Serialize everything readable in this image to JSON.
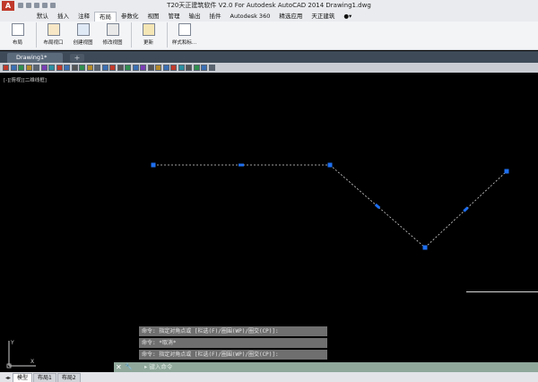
{
  "window": {
    "title": "T20天正建筑软件 V2.0 For Autodesk AutoCAD 2014    Drawing1.dwg",
    "app_logo": "A"
  },
  "menu": {
    "items": [
      "默认",
      "插入",
      "注释",
      "布局",
      "参数化",
      "视图",
      "管理",
      "输出",
      "插件",
      "Autodesk 360",
      "精选应用",
      "天正建筑",
      "●▾"
    ],
    "active_index": 3
  },
  "ribbon": {
    "buttons": [
      {
        "label": "布局",
        "icon": "layout-icon"
      },
      {
        "label": "布局视口",
        "icon": "viewport-icon"
      },
      {
        "label": "创建视图",
        "icon": "create-view-icon"
      },
      {
        "label": "修改视图",
        "icon": "modify-view-icon"
      },
      {
        "label": "更新",
        "icon": "update-icon"
      },
      {
        "label": "样式和标...",
        "icon": "styles-icon"
      }
    ]
  },
  "document_tabs": {
    "active": "Drawing1*",
    "new_tab_symbol": "+"
  },
  "viewport": {
    "label": "[-][俯视][二维线框]"
  },
  "command_history": [
    "命令: 指定对角点或 [栏选(F)/圈围(WP)/圈交(CP)]:",
    "命令: *取消*",
    "命令: 指定对角点或 [栏选(F)/圈围(WP)/圈交(CP)]:"
  ],
  "command_input": {
    "close": "✕",
    "wrench": "🔧",
    "prompt": "▸ 键入命令"
  },
  "layout_tabs": {
    "arrows": "◂▸",
    "items": [
      "模型",
      "布局1",
      "布局2"
    ],
    "active": "模型"
  },
  "ucs": {
    "y_label": "Y",
    "x_label": "X"
  },
  "colors": {
    "canvas": "#000000",
    "grip": "#1e6ff0",
    "selected_line": "#d0d0d0"
  }
}
